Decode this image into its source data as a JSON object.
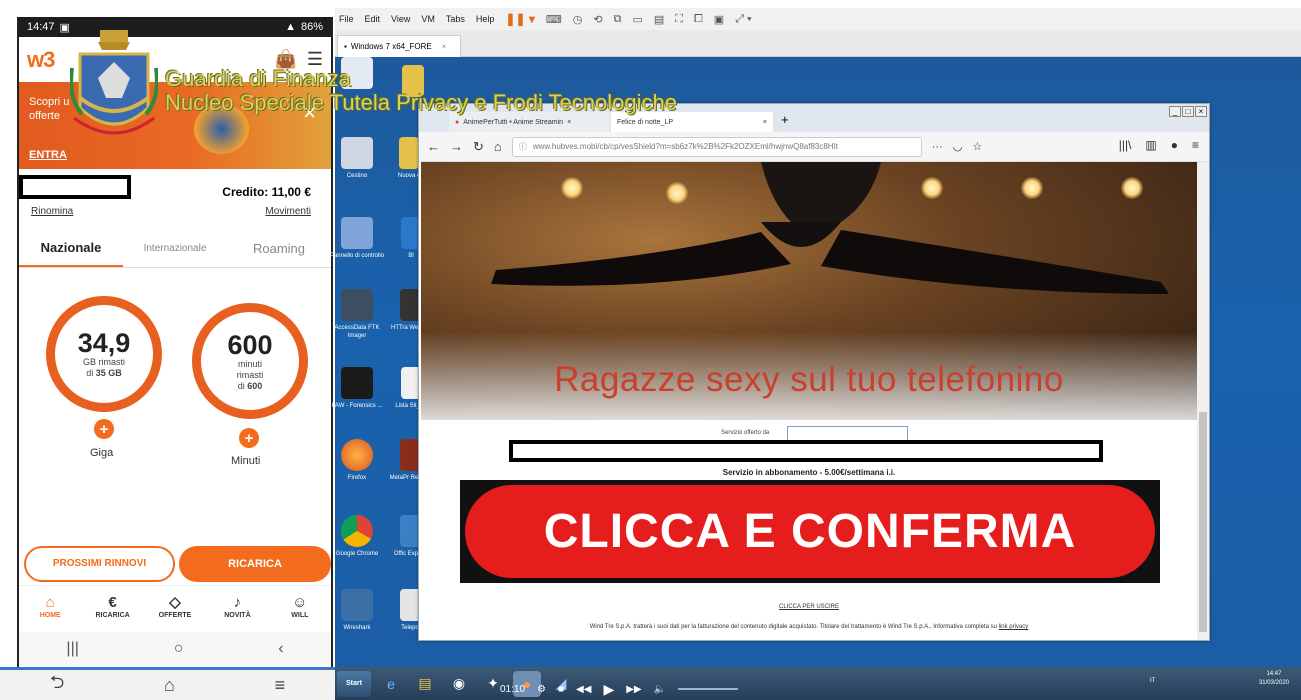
{
  "phone": {
    "status": {
      "time": "14:47",
      "battery": "86%"
    },
    "promo": {
      "line1": "Scopri u",
      "line2": "offerte",
      "cta": "ENTRA"
    },
    "account": {
      "credit": "Credito:  11,00 €",
      "rename": "Rinomina",
      "movements": "Movimenti"
    },
    "tabs": [
      {
        "label": "Nazionale"
      },
      {
        "label": "Internazionale"
      },
      {
        "label": "Roaming"
      }
    ],
    "gauges": [
      {
        "value": "34,9",
        "line1": "GB rimasti",
        "line2": "di ",
        "line2_bold": "35 GB",
        "label": "Giga",
        "remaining_fraction": 0.997
      },
      {
        "value": "600",
        "line1": "minuti",
        "line2": "rimasti",
        "line3": "di ",
        "line3_bold": "600",
        "label": "Minuti",
        "remaining_fraction": 1.0
      }
    ],
    "buttons": {
      "renewals": "PROSSIMI RINNOVI",
      "recharge": "RICARICA"
    },
    "nav": [
      {
        "label": "HOME",
        "icon": "home-icon"
      },
      {
        "label": "RICARICA",
        "icon": "euro-icon"
      },
      {
        "label": "OFFERTE",
        "icon": "tag-icon"
      },
      {
        "label": "NOVITÀ",
        "icon": "bell-icon"
      },
      {
        "label": "WILL",
        "icon": "bot-icon"
      }
    ]
  },
  "watermark": {
    "line1": "Guardia di Finanza",
    "line2": "Nucleo Speciale Tutela Privacy e Frodi Tecnologiche"
  },
  "vm": {
    "menu": [
      "File",
      "Edit",
      "View",
      "VM",
      "Tabs",
      "Help"
    ],
    "tab_title": "Windows 7 x64_FORE",
    "desktop_icons": [
      {
        "label": "Cestino"
      },
      {
        "label": "Nuova c"
      },
      {
        "label": "Pannello di controllo"
      },
      {
        "label": "Bl"
      },
      {
        "label": "AccessData FTK Imager"
      },
      {
        "label": "HTTra Website"
      },
      {
        "label": "FAW - Forensics ..."
      },
      {
        "label": "Lista Sit_de"
      },
      {
        "label": "Firefox"
      },
      {
        "label": "MetaPr Revolve"
      },
      {
        "label": "Google Chrome"
      },
      {
        "label": "Offic Explore"
      },
      {
        "label": "Wireshark"
      },
      {
        "label": "Telepor"
      }
    ],
    "taskbar": {
      "start": "Start",
      "time": "14:47",
      "date": "31/03/2020",
      "locale": "IT",
      "media_time": "01:10"
    }
  },
  "browser": {
    "tabs": [
      {
        "title": "AnimePerTutti • Anime Streamin"
      },
      {
        "title": "Felice di notte_LP"
      }
    ],
    "url": "www.hubves.mobi/cb/cp/vesShield?m=sb6z7k%2B%2Fk2OZXEml/hwjnwQ8af83c8HIt",
    "page": {
      "headline": "Ragazze sexy sul tuo telefonino",
      "service_offered_by": "Servizio offerto da",
      "subscription": "Servizio in abbonamento - 5.00€/settimana i.i.",
      "cta": "CLICCA E CONFERMA",
      "exit_link": "CLICCA PER USCIRE",
      "disclaimer": "Wind Tre S.p.A. tratterà i suoi dati per la fatturazione del contenuto digitale acquistato. Titolare del trattamento è Wind Tre S.p.A., Informativa completa su ",
      "privacy_link": "link privacy"
    }
  },
  "colors": {
    "brand_orange": "#f36b1c",
    "cta_red": "#e51d1d",
    "headline_red": "#c9402e",
    "watermark_yellow": "#d8d35a",
    "desktop_blue": "#1a62ad"
  }
}
